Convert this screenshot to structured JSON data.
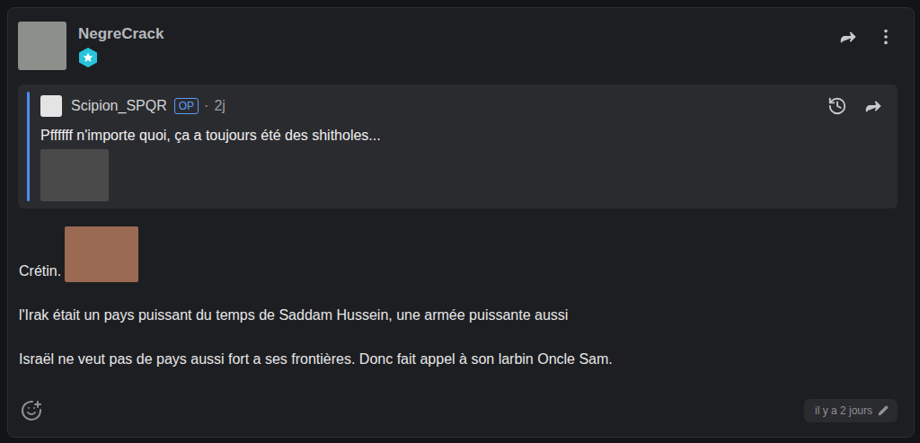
{
  "post": {
    "author": "NegreCrack",
    "timestamp": "il y a 2 jours",
    "edited": true,
    "quote": {
      "author": "Scipion_SPQR",
      "op_label": "OP",
      "separator": "·",
      "time": "2j",
      "text": "Pffffff n'importe quoi, ça a toujours été des shitholes..."
    },
    "lead": "Crétin.",
    "paragraphs": [
      "l'Irak était un pays puissant du temps de Saddam Hussein, une armée puissante aussi",
      "Israël ne veut pas de pays aussi fort a ses frontières. Donc fait appel à son larbin Oncle Sam."
    ]
  }
}
